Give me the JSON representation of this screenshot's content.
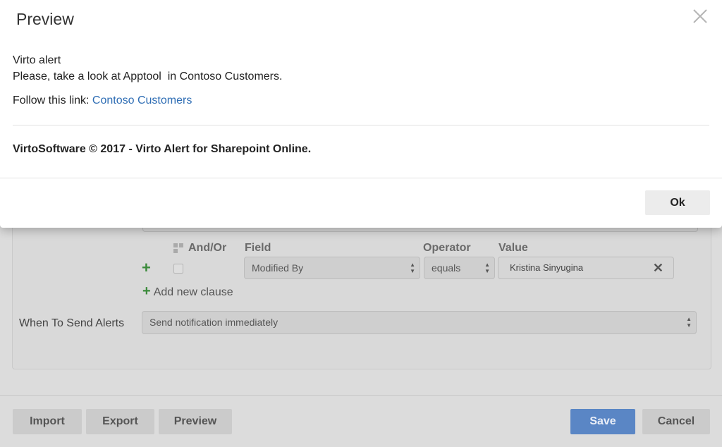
{
  "modal": {
    "title": "Preview",
    "line1": "Virto alert",
    "line2": "Please, take a look at Apptool  in Contoso Customers.",
    "follow_label": "Follow this link: ",
    "follow_link": "Contoso Customers",
    "footer": "VirtoSoftware © 2017 - Virto Alert for Sharepoint Online.",
    "ok_label": "Ok",
    "close_icon": "close-icon"
  },
  "conditions": {
    "andor_header": "And/Or",
    "field_header": "Field",
    "operator_header": "Operator",
    "value_header": "Value",
    "field_value": "Modified By",
    "operator_value": "equals",
    "value_value": "Kristina Sinyugina",
    "add_clause_label": "Add new clause"
  },
  "when": {
    "label": "When To Send Alerts",
    "value": "Send notification immediately"
  },
  "toolbar": {
    "import_label": "Import",
    "export_label": "Export",
    "preview_label": "Preview",
    "save_label": "Save",
    "cancel_label": "Cancel"
  },
  "colors": {
    "accent": "#5a86c5",
    "link": "#2e6db4",
    "add_green": "#3a8a3a"
  }
}
